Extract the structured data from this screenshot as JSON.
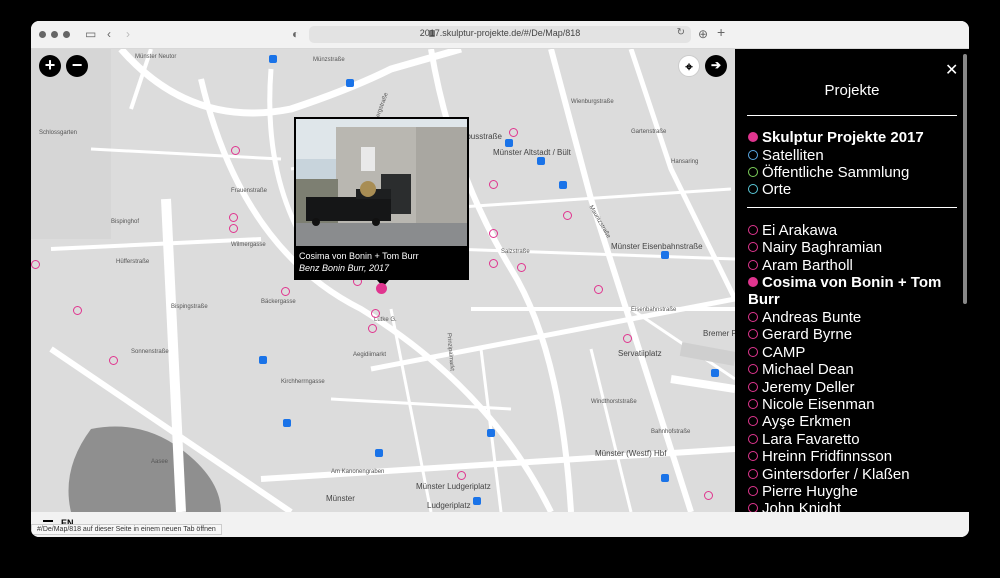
{
  "browser": {
    "url": "2017.skulptur-projekte.de/#/De/Map/818"
  },
  "map": {
    "zoom_in": "+",
    "zoom_out": "−",
    "streets": [
      "Münster Neutor",
      "Münzstraße",
      "Bergstraße",
      "Münster Tibusstraße",
      "Münster Altstadt / Bült",
      "Schlossgarten",
      "Frauenstraße",
      "Wilmergasse",
      "Hüfferstraße",
      "Bispinghof",
      "Aegidiimarkt",
      "Bäckergasse",
      "Lütke G.",
      "Prinzipalmarkt",
      "Sonnenstraße",
      "Salzstraße",
      "Mauritzstraße",
      "Münster Eisenbahnstraße",
      "Eisenbahnstraße",
      "Servatiiplatz",
      "Bremer Platz",
      "Münster (Westf) Hbf",
      "Münster Ludgeriplatz",
      "Ludgeriplatz",
      "Am Kanonengraben",
      "Gartenstraße",
      "Münster",
      "Hansaring",
      "Wienburgstraße",
      "Aasee",
      "Bispingstraße",
      "Kirchherrngasse",
      "Windthorststraße",
      "Bahnhofstraße"
    ],
    "popup": {
      "artist": "Cosima von Bonin + Tom Burr",
      "work": "Benz Bonin Burr, 2017"
    }
  },
  "sidebar": {
    "title": "Projekte",
    "close_label": "✕",
    "categories": [
      {
        "label": "Skulptur Projekte 2017",
        "color": "#e0358f",
        "filled": true
      },
      {
        "label": "Satelliten",
        "color": "#5aa9e6",
        "filled": false
      },
      {
        "label": "Öffentliche Sammlung",
        "color": "#7ccf5a",
        "filled": false
      },
      {
        "label": "Orte",
        "color": "#5ac8d8",
        "filled": false
      }
    ],
    "artists": [
      {
        "label": "Ei Arakawa"
      },
      {
        "label": "Nairy Baghramian"
      },
      {
        "label": "Aram Bartholl"
      },
      {
        "label": "Cosima von Bonin + Tom",
        "label2": "Burr",
        "active": true
      },
      {
        "label": "Andreas Bunte"
      },
      {
        "label": "Gerard Byrne"
      },
      {
        "label": "CAMP"
      },
      {
        "label": "Michael Dean"
      },
      {
        "label": "Jeremy Deller"
      },
      {
        "label": "Nicole Eisenman"
      },
      {
        "label": "Ayşe Erkmen"
      },
      {
        "label": "Lara Favaretto"
      },
      {
        "label": "Hreinn Fridfinnsson"
      },
      {
        "label": "Gintersdorfer / Klaßen"
      },
      {
        "label": "Pierre Huyghe"
      },
      {
        "label": "John Knight"
      }
    ]
  },
  "footer": {
    "lang": "EN",
    "status": "#/De/Map/818 auf dieser Seite in einem neuen Tab öffnen"
  },
  "colors": {
    "accent": "#e0358f",
    "transit": "#1a73e8",
    "map_bg": "#dcdcdc"
  }
}
